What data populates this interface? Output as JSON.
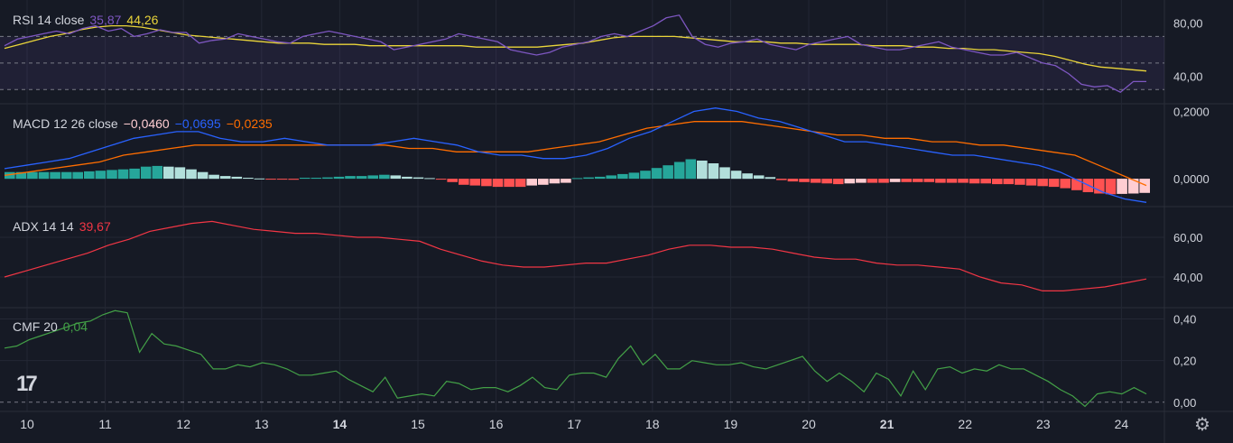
{
  "legends": {
    "rsi": {
      "name": "RSI 14 close",
      "v1": "35,87",
      "v2": "44,26"
    },
    "macd": {
      "name": "MACD 12 26 close",
      "v1": "−0,0460",
      "v2": "−0,0695",
      "v3": "−0,0235"
    },
    "adx": {
      "name": "ADX 14 14",
      "v1": "39,67"
    },
    "cmf": {
      "name": "CMF 20",
      "v1": "0,04"
    }
  },
  "colors": {
    "background": "#161a25",
    "grid": "#232734",
    "rsi": "#7e57c2",
    "rsi_ma": "#ead53a",
    "macd": "#2962ff",
    "signal": "#ff6d00",
    "hist_pos_strong": "#26a69a",
    "hist_pos_weak": "#b2dfdb",
    "hist_neg_strong": "#ff5252",
    "hist_neg_weak": "#ffcdd2",
    "adx": "#f23645",
    "cmf": "#43a047"
  },
  "icons": {
    "logo": "tradingview-logo",
    "settings": "gear-icon"
  },
  "chart_data": [
    {
      "type": "line",
      "name": "RSI",
      "x_labels": [
        "10",
        "11",
        "12",
        "13",
        "14",
        "15",
        "16",
        "17",
        "18",
        "19",
        "20",
        "21",
        "22",
        "23",
        "24"
      ],
      "y_ticks": [
        "80,00",
        "40,00"
      ],
      "levels": [
        70,
        50,
        30
      ],
      "series": [
        {
          "name": "RSI",
          "values": [
            63,
            68,
            70,
            72,
            74,
            72,
            76,
            78,
            74,
            76,
            70,
            72,
            75,
            73,
            73,
            65,
            67,
            68,
            72,
            70,
            68,
            66,
            65,
            70,
            72,
            74,
            72,
            70,
            68,
            66,
            60,
            62,
            64,
            66,
            68,
            72,
            70,
            68,
            66,
            60,
            58,
            56,
            58,
            62,
            64,
            66,
            70,
            72,
            70,
            74,
            78,
            84,
            86,
            70,
            64,
            62,
            65,
            66,
            68,
            64,
            62,
            60,
            64,
            66,
            68,
            70,
            64,
            62,
            60,
            60,
            62,
            64,
            66,
            62,
            60,
            58,
            56,
            56,
            58,
            54,
            50,
            48,
            42,
            34,
            32,
            33,
            28,
            36,
            36
          ]
        },
        {
          "name": "RSI MA",
          "values": [
            61,
            64,
            67,
            70,
            72,
            75,
            77,
            78,
            78,
            77,
            75,
            73,
            71,
            70,
            69,
            68,
            67,
            66,
            65,
            65,
            65,
            64,
            64,
            64,
            63,
            63,
            63,
            63,
            63,
            63,
            63,
            62,
            62,
            62,
            62,
            62,
            63,
            64,
            65,
            67,
            69,
            70,
            70,
            70,
            70,
            69,
            68,
            67,
            66,
            66,
            66,
            65,
            65,
            64,
            64,
            64,
            64,
            63,
            63,
            63,
            62,
            62,
            61,
            61,
            60,
            60,
            59,
            58,
            57,
            55,
            52,
            49,
            47,
            46,
            45,
            44
          ]
        }
      ]
    },
    {
      "type": "line",
      "name": "MACD",
      "y_ticks": [
        "0,2000",
        "0,0000"
      ],
      "series": [
        {
          "name": "MACD",
          "values": [
            0.03,
            0.04,
            0.05,
            0.06,
            0.08,
            0.1,
            0.12,
            0.13,
            0.14,
            0.14,
            0.12,
            0.11,
            0.11,
            0.12,
            0.11,
            0.1,
            0.1,
            0.1,
            0.11,
            0.12,
            0.11,
            0.1,
            0.08,
            0.07,
            0.07,
            0.06,
            0.06,
            0.07,
            0.09,
            0.12,
            0.14,
            0.17,
            0.2,
            0.21,
            0.2,
            0.18,
            0.17,
            0.15,
            0.13,
            0.11,
            0.11,
            0.1,
            0.09,
            0.08,
            0.07,
            0.07,
            0.06,
            0.05,
            0.04,
            0.02,
            -0.01,
            -0.04,
            -0.06,
            -0.07
          ]
        },
        {
          "name": "Signal",
          "values": [
            0.01,
            0.02,
            0.03,
            0.04,
            0.05,
            0.07,
            0.08,
            0.09,
            0.1,
            0.1,
            0.1,
            0.1,
            0.1,
            0.1,
            0.1,
            0.1,
            0.1,
            0.09,
            0.09,
            0.08,
            0.08,
            0.08,
            0.08,
            0.09,
            0.1,
            0.11,
            0.13,
            0.15,
            0.16,
            0.17,
            0.17,
            0.17,
            0.16,
            0.15,
            0.14,
            0.13,
            0.13,
            0.12,
            0.12,
            0.11,
            0.11,
            0.1,
            0.1,
            0.09,
            0.08,
            0.07,
            0.04,
            0.01,
            -0.02
          ]
        }
      ],
      "histogram": [
        0.02,
        0.02,
        0.02,
        0.02,
        0.02,
        0.02,
        0.02,
        0.022,
        0.024,
        0.026,
        0.028,
        0.03,
        0.036,
        0.038,
        0.036,
        0.034,
        0.028,
        0.02,
        0.012,
        0.008,
        0.006,
        0.003,
        0.001,
        -0.001,
        -0.002,
        -0.003,
        0.003,
        0.003,
        0.004,
        0.006,
        0.008,
        0.008,
        0.01,
        0.012,
        0.01,
        0.006,
        0.004,
        0.002,
        -0.001,
        -0.01,
        -0.018,
        -0.02,
        -0.022,
        -0.024,
        -0.024,
        -0.024,
        -0.02,
        -0.018,
        -0.014,
        -0.012,
        0.002,
        0.004,
        0.006,
        0.01,
        0.014,
        0.018,
        0.024,
        0.032,
        0.04,
        0.05,
        0.058,
        0.054,
        0.046,
        0.034,
        0.024,
        0.016,
        0.01,
        0.005,
        -0.004,
        -0.008,
        -0.01,
        -0.012,
        -0.014,
        -0.016,
        -0.014,
        -0.012,
        -0.012,
        -0.012,
        -0.01,
        -0.01,
        -0.01,
        -0.01,
        -0.012,
        -0.012,
        -0.012,
        -0.014,
        -0.014,
        -0.016,
        -0.016,
        -0.018,
        -0.02,
        -0.022,
        -0.024,
        -0.028,
        -0.034,
        -0.04,
        -0.044,
        -0.046,
        -0.045,
        -0.044,
        -0.042
      ]
    },
    {
      "type": "line",
      "name": "ADX",
      "y_ticks": [
        "60,00",
        "40,00"
      ],
      "series": [
        {
          "name": "ADX",
          "values": [
            40,
            43,
            46,
            49,
            52,
            56,
            59,
            63,
            65,
            67,
            68,
            66,
            64,
            63,
            62,
            62,
            61,
            60,
            60,
            59,
            58,
            54,
            51,
            48,
            46,
            45,
            45,
            46,
            47,
            47,
            49,
            51,
            54,
            56,
            56,
            55,
            55,
            54,
            52,
            50,
            49,
            49,
            47,
            46,
            46,
            45,
            44,
            40,
            37,
            36,
            33,
            33,
            34,
            35,
            37,
            39
          ]
        }
      ]
    },
    {
      "type": "line",
      "name": "CMF",
      "y_ticks": [
        "0,40",
        "0,20",
        "0,00"
      ],
      "series": [
        {
          "name": "CMF",
          "values": [
            0.26,
            0.27,
            0.3,
            0.32,
            0.34,
            0.36,
            0.38,
            0.39,
            0.42,
            0.44,
            0.43,
            0.24,
            0.33,
            0.28,
            0.27,
            0.25,
            0.23,
            0.16,
            0.16,
            0.18,
            0.17,
            0.19,
            0.18,
            0.16,
            0.13,
            0.13,
            0.14,
            0.15,
            0.11,
            0.08,
            0.05,
            0.12,
            0.02,
            0.03,
            0.04,
            0.03,
            0.1,
            0.09,
            0.06,
            0.07,
            0.07,
            0.05,
            0.08,
            0.12,
            0.07,
            0.06,
            0.13,
            0.14,
            0.14,
            0.12,
            0.21,
            0.27,
            0.18,
            0.23,
            0.16,
            0.16,
            0.2,
            0.19,
            0.18,
            0.18,
            0.19,
            0.17,
            0.16,
            0.18,
            0.2,
            0.22,
            0.15,
            0.1,
            0.14,
            0.1,
            0.05,
            0.14,
            0.11,
            0.03,
            0.15,
            0.06,
            0.16,
            0.17,
            0.14,
            0.16,
            0.15,
            0.18,
            0.16,
            0.16,
            0.13,
            0.1,
            0.06,
            0.03,
            -0.02,
            0.04,
            0.05,
            0.04,
            0.07,
            0.04
          ]
        }
      ]
    }
  ]
}
